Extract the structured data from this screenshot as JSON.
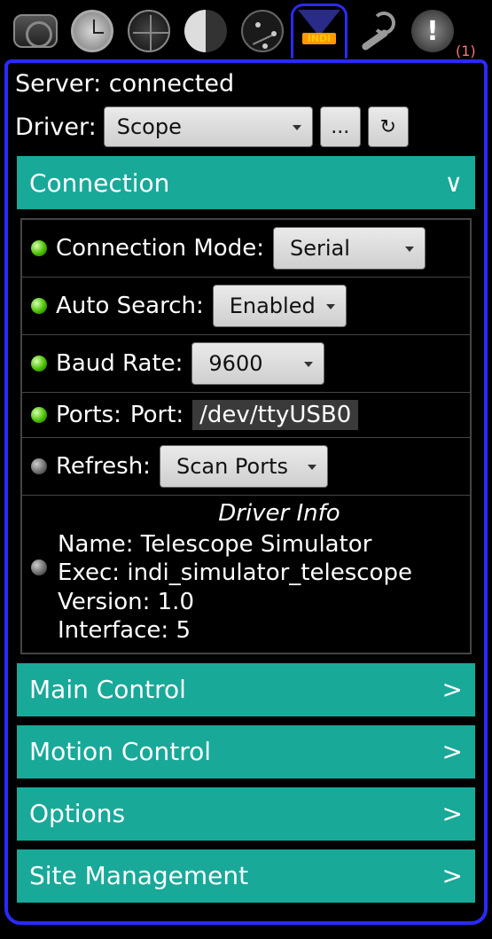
{
  "toolbar": {
    "alert_badge": "(1)",
    "indi_label": "INDI"
  },
  "header": {
    "server_label": "Server:",
    "server_status": "connected",
    "driver_label": "Driver:",
    "driver_value": "Scope",
    "more_label": "...",
    "refresh_label": "↻"
  },
  "groups": {
    "connection": {
      "title": "Connection",
      "chev": "∨"
    },
    "main_control": {
      "title": "Main Control",
      "chev": ">"
    },
    "motion_control": {
      "title": "Motion Control",
      "chev": ">"
    },
    "options": {
      "title": "Options",
      "chev": ">"
    },
    "site_management": {
      "title": "Site Management",
      "chev": ">"
    }
  },
  "conn": {
    "mode_label": "Connection Mode:",
    "mode_value": "Serial",
    "autosearch_label": "Auto Search:",
    "autosearch_value": "Enabled",
    "baud_label": "Baud Rate:",
    "baud_value": "9600",
    "ports_label": "Ports:",
    "port_field_label": "Port:",
    "port_value": "/dev/ttyUSB0",
    "refresh_label": "Refresh:",
    "refresh_value": "Scan Ports",
    "driver_info_title": "Driver Info",
    "name_label": "Name:",
    "name_value": "Telescope Simulator",
    "exec_label": "Exec:",
    "exec_value": "indi_simulator_telescope",
    "version_label": "Version:",
    "version_value": "1.0",
    "iface_label": "Interface:",
    "iface_value": "5"
  }
}
